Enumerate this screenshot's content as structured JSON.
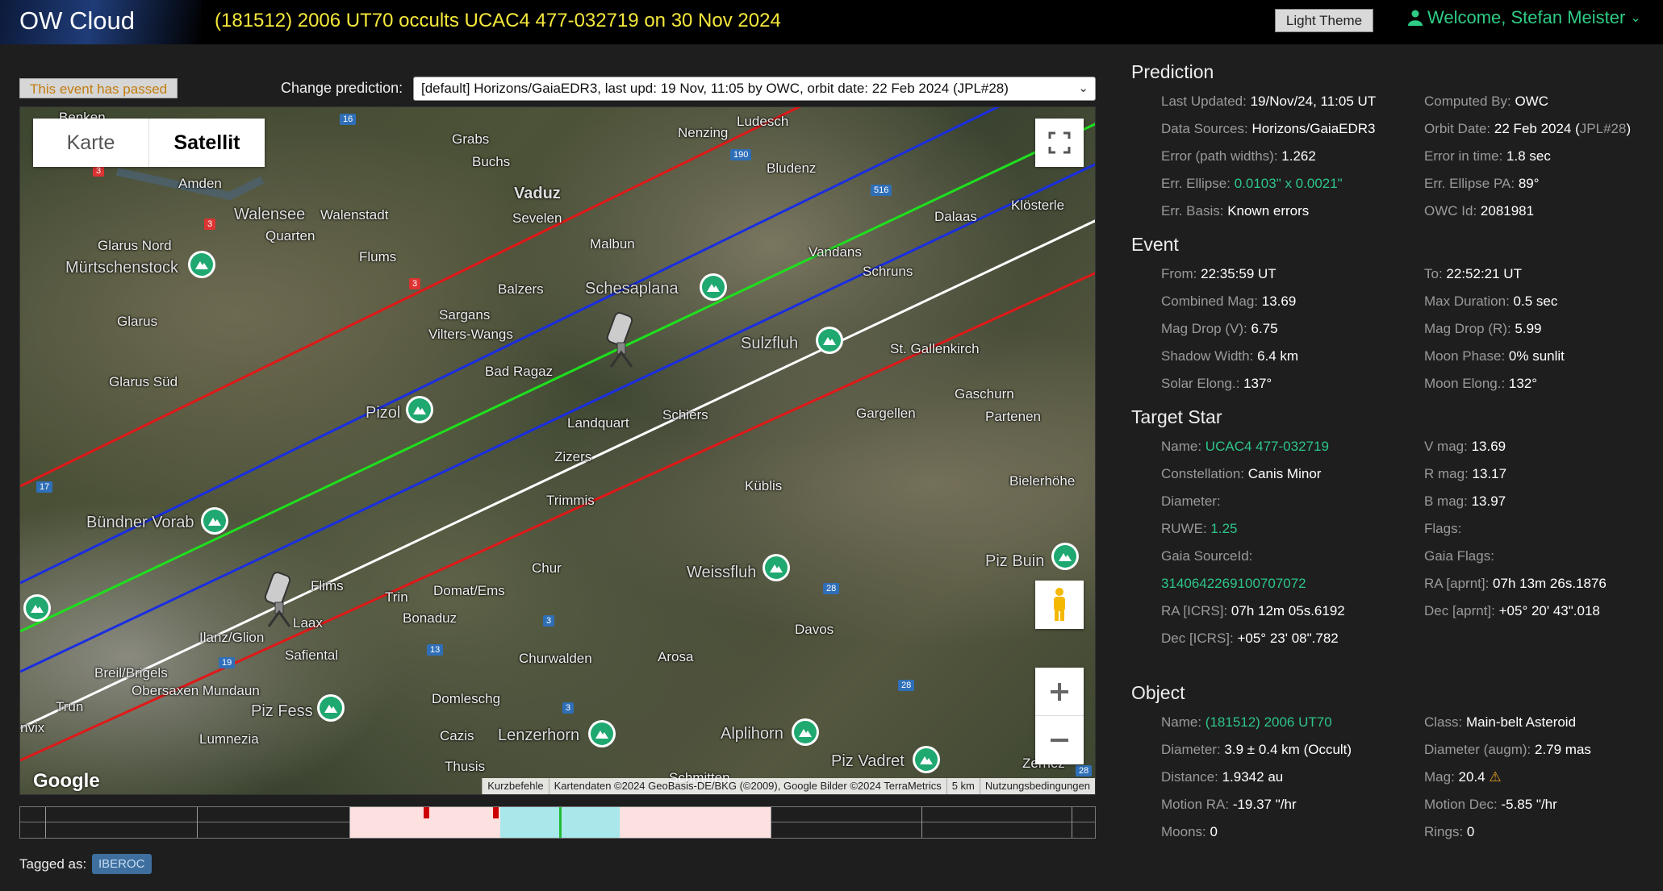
{
  "header": {
    "app_name": "OW Cloud",
    "event_title": "(181512) 2006 UT70 occults UCAC4 477-032719 on 30 Nov 2024",
    "theme_button": "Light Theme",
    "welcome": "Welcome, Stefan Meister"
  },
  "controls": {
    "passed_badge": "This event has passed",
    "change_label": "Change prediction:",
    "prediction_selected": "[default] Horizons/GaiaEDR3, last upd: 19 Nov, 11:05 by OWC, orbit date: 22 Feb 2024 (JPL#28)"
  },
  "map": {
    "type_buttons": [
      "Karte",
      "Satellit"
    ],
    "active_type": "Satellit",
    "google": "Google",
    "footer": [
      "Kurzbefehle",
      "Kartendaten ©2024 GeoBasis-DE/BKG (©2009), Google Bilder ©2024 TerraMetrics",
      "5 km",
      "Nutzungsbedingungen"
    ],
    "labels": [
      "Benken",
      "Grabs",
      "Nenzing",
      "Ludesch",
      "Buchs",
      "Bludenz",
      "Amden",
      "Vaduz",
      "Walensee",
      "Walenstadt",
      "Sevelen",
      "Dalaas",
      "Klösterle",
      "Quarten",
      "Glarus Nord",
      "Flums",
      "Malbun",
      "Vandans",
      "Mürtschenstock",
      "Schruns",
      "Balzers",
      "Schesaplana",
      "Glarus",
      "Sargans",
      "Vilters-Wangs",
      "Sulzfluh",
      "St. Gallenkirch",
      "Bad Ragaz",
      "Glarus Süd",
      "Gaschurn",
      "Pizol",
      "Landquart",
      "Schiers",
      "Gargellen",
      "Partenen",
      "Zizers",
      "Küblis",
      "Bielerhöhe",
      "Trimmis",
      "Bündner Vorab",
      "Chur",
      "Piz Buin",
      "Flims",
      "Weissfluh",
      "Domat/Ems",
      "Trin",
      "Laax",
      "Bonaduz",
      "Ilanz/Glion",
      "Davos",
      "Safiental",
      "Breil/Brigels",
      "Churwalden",
      "Arosa",
      "Obersaxen Mundaun",
      "Domleschg",
      "Trun",
      "Piz Fess",
      "Lenzerhorn",
      "Alplihorn",
      "Cazis",
      "Lumnezia",
      "Thusis",
      "Schmitten",
      "Piz Vadret",
      "Zernez",
      "nvix"
    ],
    "roads": [
      "16",
      "3",
      "190",
      "3",
      "516",
      "3",
      "17",
      "3",
      "13",
      "28",
      "19",
      "3",
      "28",
      "28"
    ]
  },
  "timeline": {
    "tagged_label": "Tagged as:",
    "tag": "IBEROC"
  },
  "prediction": {
    "title": "Prediction",
    "rows": [
      {
        "k": "Last Updated: ",
        "v": "19/Nov/24, 11:05 UT"
      },
      {
        "k": "Computed By: ",
        "v": "OWC"
      },
      {
        "k": "Data Sources: ",
        "v": "Horizons/GaiaEDR3"
      },
      {
        "k": "Orbit Date: ",
        "v": "22 Feb 2024 (",
        "v2": "JPL#28",
        "v3": ")"
      },
      {
        "k": "Error (path widths): ",
        "v": "1.262"
      },
      {
        "k": "Error in time: ",
        "v": "1.8 sec"
      },
      {
        "k": "Err. Ellipse: ",
        "v": "0.0103\" x 0.0021\""
      },
      {
        "k": "Err. Ellipse PA: ",
        "v": "89°"
      },
      {
        "k": "Err. Basis: ",
        "v": "Known errors"
      },
      {
        "k": "OWC Id: ",
        "v": "2081981"
      }
    ]
  },
  "event": {
    "title": "Event",
    "rows": [
      {
        "k": "From: ",
        "v": "22:35:59 UT"
      },
      {
        "k": "To: ",
        "v": "22:52:21 UT"
      },
      {
        "k": "Combined Mag: ",
        "v": "13.69"
      },
      {
        "k": "Max Duration: ",
        "v": "0.5 sec"
      },
      {
        "k": "Mag Drop (V): ",
        "v": "6.75"
      },
      {
        "k": "Mag Drop (R): ",
        "v": "5.99"
      },
      {
        "k": "Shadow Width: ",
        "v": "6.4 km"
      },
      {
        "k": "Moon Phase: ",
        "v": "0% sunlit"
      },
      {
        "k": "Solar Elong.: ",
        "v": "137°"
      },
      {
        "k": "Moon Elong.: ",
        "v": "132°"
      }
    ]
  },
  "target": {
    "title": "Target Star",
    "rows": [
      {
        "k": "Name: ",
        "v": "UCAC4 477-032719"
      },
      {
        "k": "V mag: ",
        "v": "13.69"
      },
      {
        "k": "Constellation: ",
        "v": "Canis Minor"
      },
      {
        "k": "R mag: ",
        "v": "13.17"
      },
      {
        "k": "Diameter: ",
        "v": ""
      },
      {
        "k": "B mag: ",
        "v": "13.97"
      },
      {
        "k": "RUWE: ",
        "v": "1.25"
      },
      {
        "k": "Flags: ",
        "v": ""
      },
      {
        "k": "Gaia SourceId: ",
        "v": ""
      },
      {
        "k": "Gaia Flags: ",
        "v": ""
      },
      {
        "k": "",
        "v": "3140642269100707072"
      },
      {
        "k": "RA [aprnt]: ",
        "v": "07h 13m 26s.1876"
      },
      {
        "k": "RA [ICRS]: ",
        "v": "07h 12m 05s.6192"
      },
      {
        "k": "Dec [aprnt]: ",
        "v": "+05° 20' 43\".018"
      },
      {
        "k": "Dec [ICRS]: ",
        "v": "+05° 23' 08\".782"
      }
    ]
  },
  "object": {
    "title": "Object",
    "rows": [
      {
        "k": "Name: ",
        "v": "(181512) 2006 UT70"
      },
      {
        "k": "Class: ",
        "v": "Main-belt Asteroid"
      },
      {
        "k": "Diameter: ",
        "v": "3.9 ± 0.4 km  (Occult)"
      },
      {
        "k": "Diameter (augm): ",
        "v": "2.79 mas"
      },
      {
        "k": "Distance: ",
        "v": "1.9342 au"
      },
      {
        "k": "Mag: ",
        "v": "20.4"
      },
      {
        "k": "Motion RA: ",
        "v": "-19.37 \"/hr"
      },
      {
        "k": "Motion Dec: ",
        "v": "-5.85 \"/hr"
      },
      {
        "k": "Moons: ",
        "v": "0"
      },
      {
        "k": "Rings: ",
        "v": "0"
      }
    ]
  },
  "colors": {
    "accent_green": "#2ecc85",
    "title_yellow": "#f5e83a",
    "link_green": "#2ec58a",
    "path_red": "#e01818",
    "path_blue": "#1a2ee0",
    "path_green": "#1ee01e",
    "path_white": "#ffffff"
  }
}
